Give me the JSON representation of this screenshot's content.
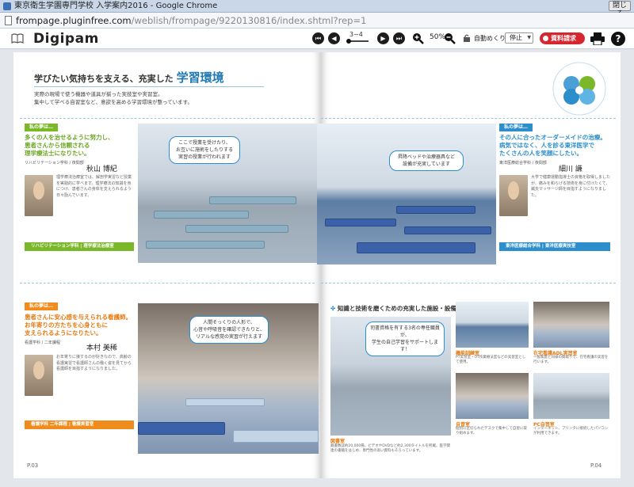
{
  "window": {
    "title": "東京衛生学園専門学校 入学案内2016 - Google Chrome",
    "close_label": "閉じる"
  },
  "address": {
    "host": "frompage.pluginfree.com",
    "path": "/weblish/frompage/9220130816/index.shtml?rep=1"
  },
  "toolbar": {
    "brand": "Digipam",
    "page_range": "3~4",
    "zoom": "50%",
    "auto_label": "自動めくり",
    "auto_select_value": "停止",
    "request_label": "資料請求",
    "help_label": "?"
  },
  "spread": {
    "headline_prefix": "学びたい気持ちを支える、充実した",
    "headline_accent": "学習環境",
    "intro_line1": "実際の現場で使う機器や道具が揃った実技室や実習室。",
    "intro_line2": "集中して学べる自習室など、意欲を高める学習環境が整っています。",
    "left_top": {
      "tag": "私の夢は…",
      "lead1": "多くの人を治せるように努力し、",
      "lead2": "患者さんから信頼される",
      "lead3": "理学療法士になりたい。",
      "meta": "リハビリテーション学科 / 夜間部",
      "name": "秋山 博紀",
      "body": "理学療法治療室では、解剖学実習など授業を実践的に学べます。理学療法の知識を身につけ、患者さんの身体を支えられるよう日々励んでいます。",
      "bubble1": "ここで授業を受けたり、",
      "bubble2": "お互いに施術をしたりする",
      "bubble3": "実習の授業が行われます",
      "footer": "リハビリテーション学科 | 理学療法治療室"
    },
    "right_top": {
      "tag": "私の夢は…",
      "lead1": "その人に合ったオーダーメイドの治療。",
      "lead2": "病気ではなく、人を診る東洋医学で",
      "lead3": "たくさんの人を笑顔にしたい。",
      "meta": "東洋医療総合学科 / 夜間部",
      "name": "細川 謙",
      "body": "大学で健康運動指導士の資格を取得しましたが、痛みを和らげる技術を身に付けたくて、鍼灸マッサージ師を目指すようになりました。",
      "bubble1": "昇降ベッドや治療器具など",
      "bubble2": "設備が充実しています",
      "footer": "東洋医療総合学科 | 東洋医療実技室"
    },
    "left_bottom": {
      "tag": "私の夢は…",
      "lead1": "患者さんに安心感を与えられる看護師。",
      "lead2": "お年寄りの方たちを心身ともに",
      "lead3": "支えられるようになりたい。",
      "meta": "看護学科 / 二年課程",
      "name": "本村 美稀",
      "body": "お年寄りに接するのが好きなので、高齢の看護実習で看護師さんの働く姿を見てから看護師を目指すようになりました。",
      "bubble1": "人間そっくりの人形で、",
      "bubble2": "心音や呼吸音を確認できたりと、",
      "bubble3": "リアルな感覚の実習が行えます",
      "footer": "看護学科 二年課程 | 看護実習室"
    },
    "right_bottom": {
      "title": "知識と技術を磨くための充実した施設・設備",
      "bubble1": "司書資格を有する3名の専任職員が、",
      "bubble2": "学生の自己学習をサポートします！",
      "library_label": "図書室",
      "library_text": "蔵書数は約20,000冊。ビデオやDVDなど約2,300タイトルを所蔵。医学関連の書籍をはじめ、専門性の高い資料もそろっています。",
      "facility1_label": "機能訓練室",
      "facility1_text": "PT実習室・OT作業療法室などの実習室として使用。",
      "facility2_label": "在宅看護ADL実習室",
      "facility2_text": "一般家庭と同様の間取りで、在宅看護の実習を行います。",
      "facility3_label": "自習室",
      "facility3_text": "個別に区切られたデスクで集中して自習に取り組めます。",
      "facility4_label": "PC自習室",
      "facility4_text": "インターネット、プリンタに接続したパソコンが利用できます。"
    },
    "folio_left": "P.03",
    "folio_right": "P.04"
  }
}
